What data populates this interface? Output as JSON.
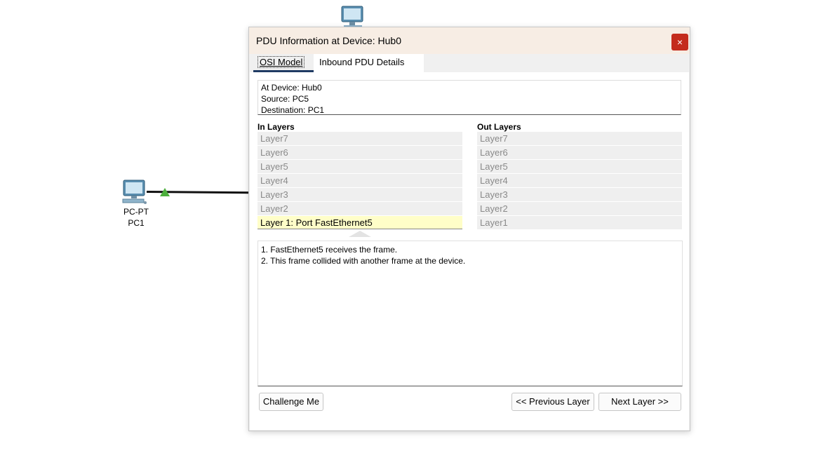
{
  "workspace": {
    "pc1": {
      "type_label": "PC-PT",
      "name_label": "PC1"
    },
    "link_status_color": "#4caf3c"
  },
  "dialog": {
    "title": "PDU Information at Device: Hub0",
    "close_label": "×",
    "tabs": [
      {
        "label": "OSI Model",
        "active": true
      },
      {
        "label": "Inbound PDU Details",
        "active": false
      }
    ],
    "info": {
      "device": "At Device: Hub0",
      "source": "Source: PC5",
      "destination": "Destination: PC1"
    },
    "in_layers": {
      "heading": "In Layers",
      "items": [
        "Layer7",
        "Layer6",
        "Layer5",
        "Layer4",
        "Layer3",
        "Layer2",
        "Layer 1: Port FastEthernet5"
      ]
    },
    "out_layers": {
      "heading": "Out Layers",
      "items": [
        "Layer7",
        "Layer6",
        "Layer5",
        "Layer4",
        "Layer3",
        "Layer2",
        "Layer1"
      ]
    },
    "description": [
      "1. FastEthernet5 receives the frame.",
      "2. This frame collided with another frame at the device."
    ],
    "buttons": {
      "challenge": "Challenge Me",
      "previous": "<< Previous Layer",
      "next": "Next Layer >>"
    },
    "colors": {
      "close_bg": "#c42b1c",
      "highlight_layer": "#fffec8",
      "tab_underline": "#1f3b63"
    }
  }
}
